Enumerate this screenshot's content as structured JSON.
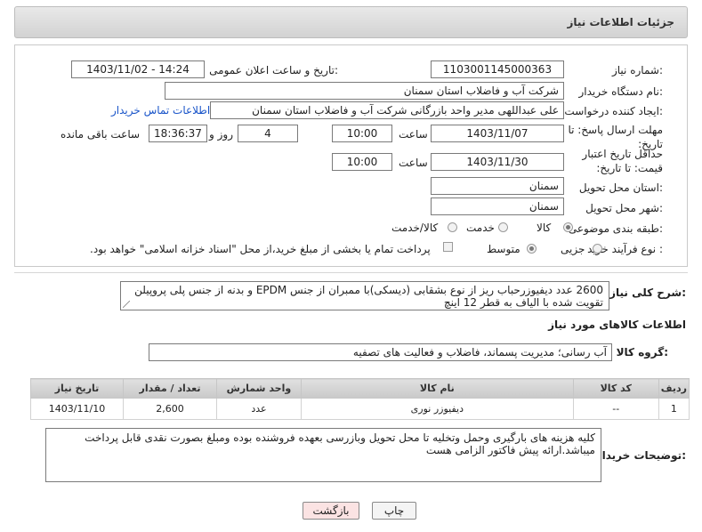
{
  "header": {
    "title": "جزئیات اطلاعات نیاز"
  },
  "form": {
    "need_number_label": "شماره نیاز:",
    "need_number": "1103001145000363",
    "announce_label": "تاریخ و ساعت اعلان عمومی:",
    "announce_value": "1403/11/02 - 14:24",
    "buyer_org_label": "نام دستگاه خریدار:",
    "buyer_org": "شرکت آب و فاضلاب استان سمنان",
    "creator_label": "ایجاد کننده درخواست:",
    "creator": "علی عبداللهی مدیر واحد بازرگانی شرکت آب و فاضلاب استان سمنان",
    "contact_link": "اطلاعات تماس خریدار",
    "deadline_label": "مهلت ارسال پاسخ: تا تاریخ:",
    "deadline_date": "1403/11/07",
    "time_label": "ساعت",
    "deadline_time": "10:00",
    "days_value": "4",
    "days_and_label": "روز و",
    "remaining_time": "18:36:37",
    "remaining_label": "ساعت باقی مانده",
    "validity_label": "حداقل تاریخ اعتبار قیمت: تا تاریخ:",
    "validity_date": "1403/11/30",
    "validity_time": "10:00",
    "province_label": "استان محل تحویل:",
    "province": "سمنان",
    "city_label": "شهر محل تحویل:",
    "city": "سمنان",
    "category_label": "طبقه بندی موضوعی:",
    "category_options": [
      "کالا",
      "خدمت",
      "کالا/خدمت"
    ],
    "process_label": "نوع فرآیند خرید :",
    "process_options": [
      "جزیی",
      "متوسط"
    ],
    "payment_note": "پرداخت تمام یا بخشی از مبلغ خرید،از محل \"اسناد خزانه اسلامی\" خواهد بود."
  },
  "summary": {
    "label": "شرح کلی نیاز:",
    "text": "2600 عدد دیفیوزرحباب ریز از نوع بشقابی (دیسکی)با ممبران از جنس EPDM و بدنه از جنس پلی پروپیلن تقویت شده با الیاف به قطر 12 اینچ"
  },
  "goods": {
    "section_title": "اطلاعات کالاهای مورد نیاز",
    "group_label": "گروه کالا:",
    "group_value": "آب رسانی؛ مدیریت پسماند، فاضلاب و فعالیت های تصفیه",
    "columns": [
      "ردیف",
      "کد کالا",
      "نام کالا",
      "واحد شمارش",
      "تعداد / مقدار",
      "تاریخ نیاز"
    ],
    "rows": [
      {
        "row": "1",
        "code": "--",
        "name": "دیفیوزر نوری",
        "unit": "عدد",
        "qty": "2,600",
        "date": "1403/11/10"
      }
    ]
  },
  "buyer_notes": {
    "label": "توضیحات خریدار:",
    "text": "کلیه هزینه های بارگیری وحمل وتخلیه تا محل تحویل وبازرسی بعهده فروشنده بوده ومبلغ بصورت نقدی قابل پرداخت میباشد.ارائه پیش فاکتور الزامی هست"
  },
  "buttons": {
    "print": "چاپ",
    "back": "بازگشت"
  },
  "colors": {
    "link": "#1a55c9",
    "back_button_bg": "#fbe3e3",
    "header_bg": "#d9d9d9"
  }
}
